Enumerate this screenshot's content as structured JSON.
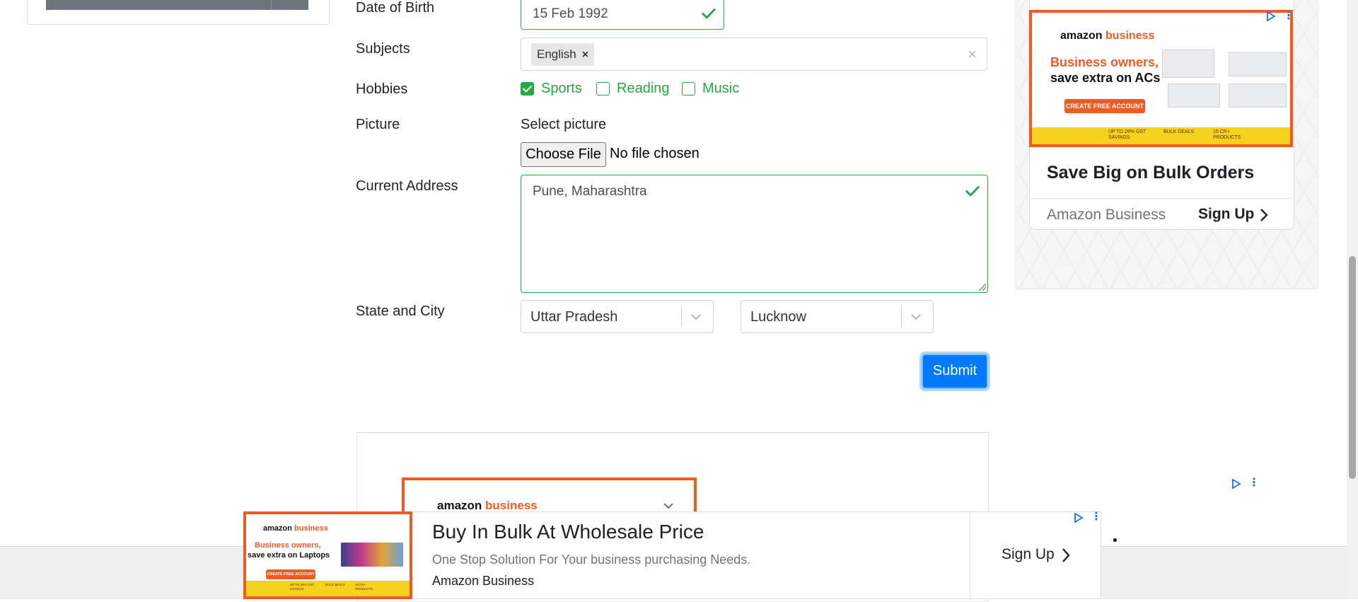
{
  "form": {
    "dob_label": "Date of Birth",
    "dob_value": "15 Feb 1992",
    "subjects_label": "Subjects",
    "subjects_chips": [
      "English"
    ],
    "hobbies_label": "Hobbies",
    "hobbies": [
      {
        "label": "Sports",
        "checked": true
      },
      {
        "label": "Reading",
        "checked": false
      },
      {
        "label": "Music",
        "checked": false
      }
    ],
    "picture_label": "Picture",
    "picture_prompt": "Select picture",
    "choose_file_label": "Choose File",
    "file_status": "No file chosen",
    "address_label": "Current Address",
    "address_value": "Pune, Maharashtra",
    "state_city_label": "State and City",
    "state_value": "Uttar Pradesh",
    "city_value": "Lucknow",
    "submit_label": "Submit"
  },
  "right_ad": {
    "brand_word1": "amazon",
    "brand_word2": "business",
    "headline_line1": "Business owners,",
    "headline_line2": "save extra on ACs",
    "cta": "CREATE FREE ACCOUNT",
    "strip_items": [
      "UP TO 28% GST SAVINGS",
      "BULK DEALS",
      "15 CR+ PRODUCTS"
    ],
    "title": "Save Big on Bulk Orders",
    "advertiser": "Amazon Business",
    "action": "Sign Up"
  },
  "mid_ad": {
    "brand_word1": "amazon",
    "brand_word2": "business"
  },
  "bottom_ad": {
    "brand_word1": "amazon",
    "brand_word2": "business",
    "banner_line1": "Business owners,",
    "banner_line2": "save extra on Laptops",
    "banner_cta": "CREATE FREE ACCOUNT",
    "strip_items": [
      "UP TO 28% GST SAVINGS",
      "BULK DEALS",
      "15 CR+ PRODUCTS"
    ],
    "title": "Buy In Bulk At Wholesale Price",
    "description": "One Stop Solution For Your business purchasing Needs.",
    "advertiser": "Amazon Business",
    "action": "Sign Up"
  },
  "colors": {
    "valid_green": "#28a745",
    "primary_blue": "#007bff",
    "amazon_orange": "#f15a22",
    "strip_yellow": "#f5d21e"
  }
}
